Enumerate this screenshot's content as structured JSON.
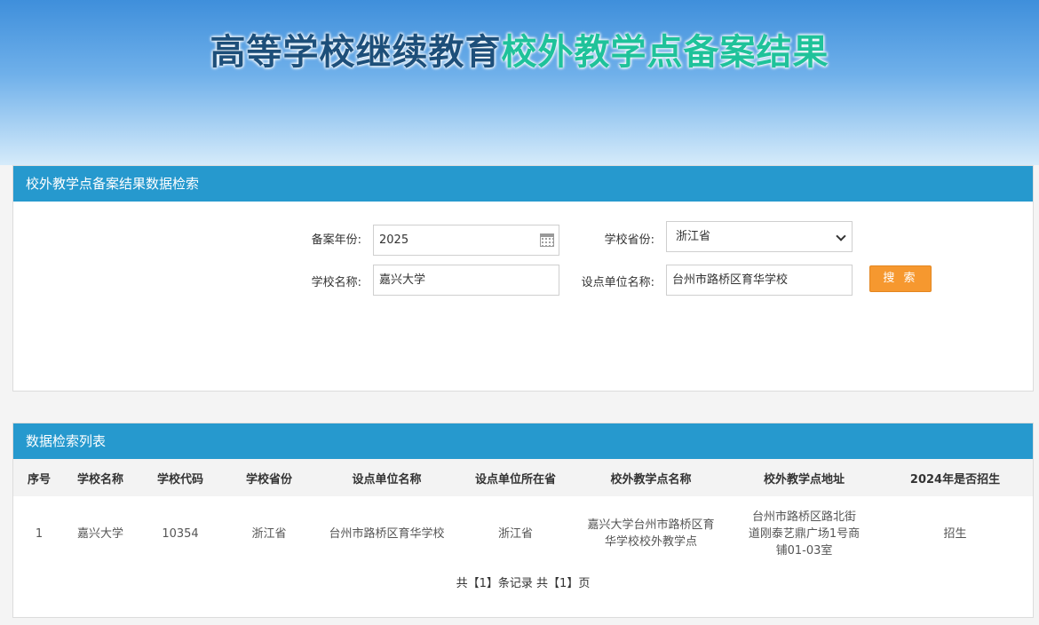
{
  "banner": {
    "title_part1": "高等学校继续教育",
    "title_part2": "校外教学点备案结果"
  },
  "search": {
    "header": "校外教学点备案结果数据检索",
    "year_label": "备案年份:",
    "year_value": "2025",
    "province_label": "学校省份:",
    "province_value": "浙江省",
    "school_label": "学校名称:",
    "school_value": "嘉兴大学",
    "unit_label": "设点单位名称:",
    "unit_value": "台州市路桥区育华学校",
    "button_label": "搜 索"
  },
  "results": {
    "header": "数据检索列表",
    "columns": [
      "序号",
      "学校名称",
      "学校代码",
      "学校省份",
      "设点单位名称",
      "设点单位所在省",
      "校外教学点名称",
      "校外教学点地址",
      "2024年是否招生"
    ],
    "rows": [
      {
        "index": "1",
        "school": "嘉兴大学",
        "code": "10354",
        "province": "浙江省",
        "unit": "台州市路桥区育华学校",
        "unit_province": "浙江省",
        "site_name": "嘉兴大学台州市路桥区育华学校校外教学点",
        "site_address": "台州市路桥区路北街道刚泰艺鼎广场1号商铺01-03室",
        "enrolling": "招生"
      }
    ],
    "pager": "共【1】条记录 共【1】页"
  }
}
